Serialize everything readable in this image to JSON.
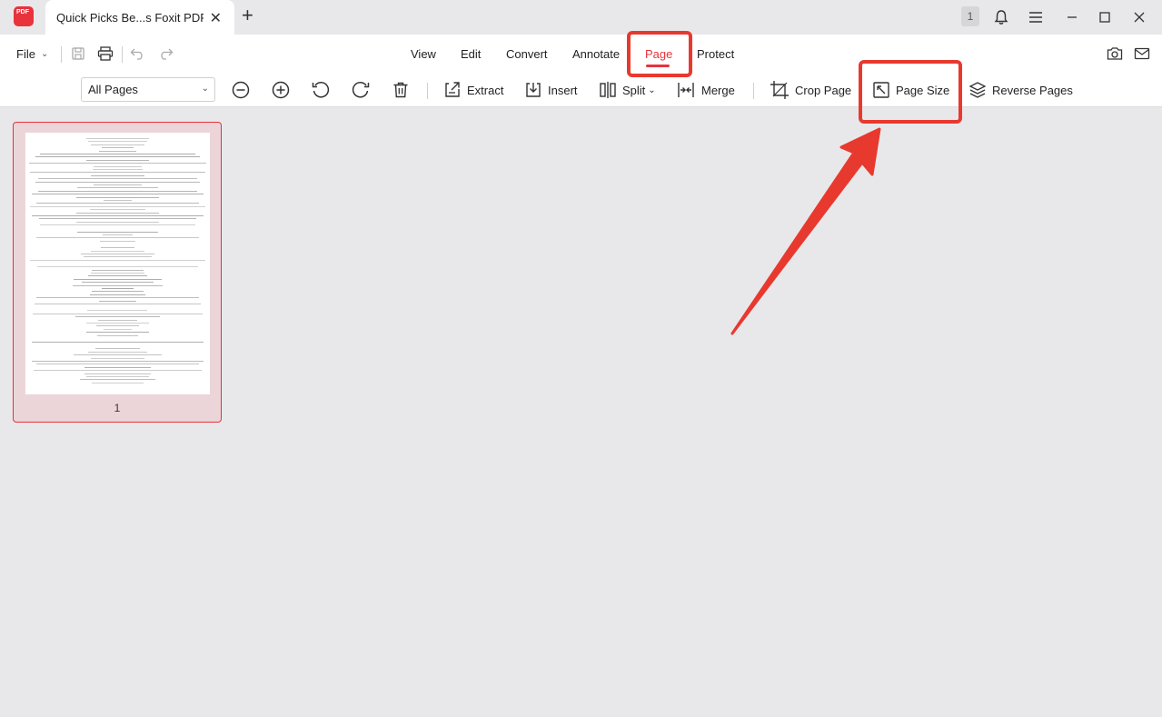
{
  "window": {
    "app_logo_text": "PDF",
    "tab_title": "Quick Picks Be...s Foxit PDF Re",
    "notification_count": "1"
  },
  "menu": {
    "file_label": "File",
    "items": [
      "View",
      "Edit",
      "Convert",
      "Annotate",
      "Page",
      "Protect"
    ],
    "active": "Page"
  },
  "toolbar": {
    "page_range": "All Pages",
    "extract_label": "Extract",
    "insert_label": "Insert",
    "split_label": "Split",
    "merge_label": "Merge",
    "crop_label": "Crop Page",
    "page_size_label": "Page Size",
    "reverse_label": "Reverse Pages"
  },
  "thumbnails": [
    {
      "page_number": "1",
      "selected": true
    }
  ],
  "colors": {
    "accent": "#e8323c",
    "highlight": "#e8392f",
    "selected_bg": "#ecd5d8"
  },
  "icons": [
    "close-icon",
    "plus-icon",
    "bell-icon",
    "hamburger-icon",
    "minimize-icon",
    "maximize-icon",
    "save-icon",
    "print-icon",
    "undo-icon",
    "redo-icon",
    "camera-icon",
    "mail-icon",
    "zoom-out-icon",
    "zoom-in-icon",
    "rotate-left-icon",
    "rotate-right-icon",
    "trash-icon",
    "extract-icon",
    "insert-icon",
    "split-icon",
    "merge-icon",
    "crop-icon",
    "page-size-icon",
    "reverse-pages-icon"
  ]
}
